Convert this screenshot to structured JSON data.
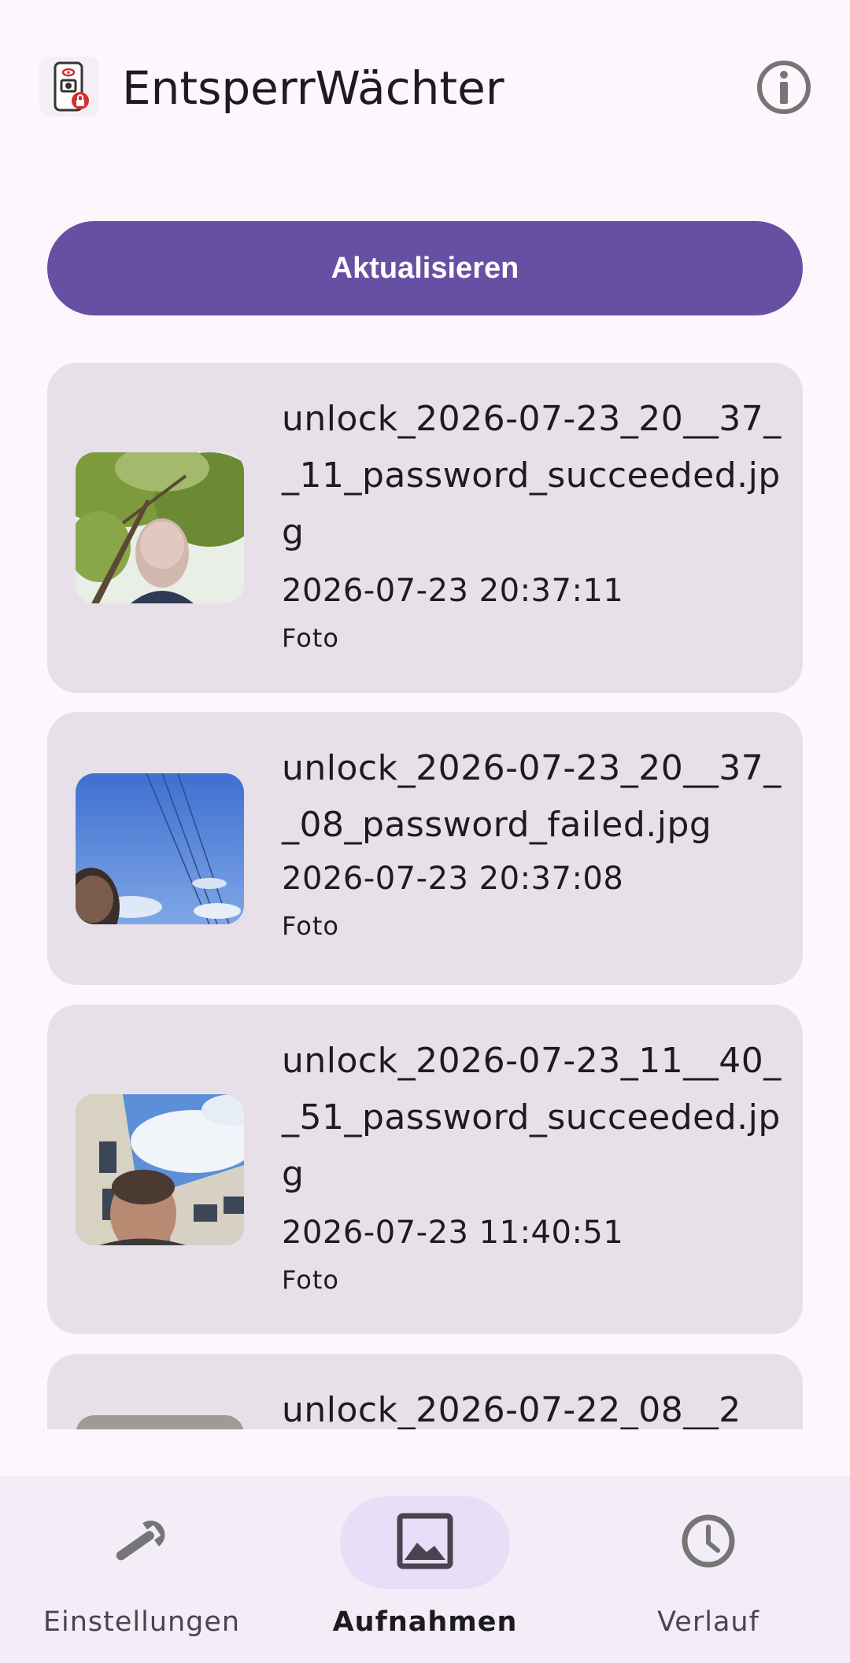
{
  "app": {
    "title": "EntsperrWächter",
    "logo_icon": "phone-camera-lock-icon",
    "info_icon": "info-icon"
  },
  "actions": {
    "refresh_label": "Aktualisieren"
  },
  "captures": [
    {
      "filename": "unlock_2026-07-23_20__37__11_password_succeeded.jpg",
      "timestamp": "2026-07-23 20:37:11",
      "type": "Foto",
      "thumbnail": "tree-selfie-thumbnail"
    },
    {
      "filename": "unlock_2026-07-23_20__37__08_password_failed.jpg",
      "timestamp": "2026-07-23 20:37:08",
      "type": "Foto",
      "thumbnail": "sky-thumbnail"
    },
    {
      "filename": "unlock_2026-07-23_11__40__51_password_succeeded.jpg",
      "timestamp": "2026-07-23 11:40:51",
      "type": "Foto",
      "thumbnail": "building-selfie-thumbnail"
    },
    {
      "filename": "unlock_2026-07-22_08__2",
      "thumbnail": "partial-thumbnail"
    }
  ],
  "nav": {
    "items": [
      {
        "label": "Einstellungen",
        "icon": "wrench-icon",
        "active": false
      },
      {
        "label": "Aufnahmen",
        "icon": "image-icon",
        "active": true
      },
      {
        "label": "Verlauf",
        "icon": "clock-icon",
        "active": false
      }
    ]
  },
  "colors": {
    "background": "#fdf7fd",
    "primary": "#6750a4",
    "card": "#e7e0e8",
    "nav_background": "#f3edf7",
    "nav_indicator": "#e8def8"
  }
}
